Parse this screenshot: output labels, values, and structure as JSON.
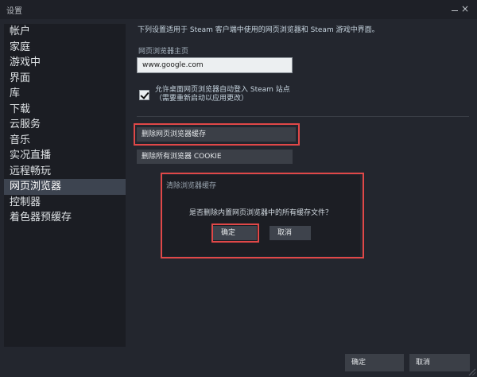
{
  "window": {
    "title": "设置",
    "minimize": "—",
    "close": "×"
  },
  "sidebar": {
    "items": [
      {
        "label": "帐户"
      },
      {
        "label": "家庭"
      },
      {
        "label": "游戏中"
      },
      {
        "label": "界面"
      },
      {
        "label": "库"
      },
      {
        "label": "下载"
      },
      {
        "label": "云服务"
      },
      {
        "label": "音乐"
      },
      {
        "label": "实况直播"
      },
      {
        "label": "远程畅玩"
      },
      {
        "label": "网页浏览器",
        "active": true
      },
      {
        "label": "控制器"
      },
      {
        "label": "着色器预缓存"
      }
    ]
  },
  "browser": {
    "description": "下列设置适用于 Steam 客户端中使用的网页浏览器和 Steam 游戏中界面。",
    "home_label": "网页浏览器主页",
    "home_value": "www.google.com",
    "auto_login_line1": "允许桌面网页浏览器自动登入 Steam 站点",
    "auto_login_line2": "（需要重新启动以应用更改）",
    "auto_login_checked": true,
    "delete_cache_label": "删除网页浏览器缓存",
    "delete_cookies_label": "删除所有浏览器 COOKIE"
  },
  "dialog": {
    "title": "清除浏览器缓存",
    "message": "是否删除内置网页浏览器中的所有缓存文件？",
    "ok_label": "确定",
    "cancel_label": "取消"
  },
  "footer": {
    "ok_label": "确定",
    "cancel_label": "取消"
  },
  "colors": {
    "background": "#23262e",
    "sidebar": "#1b1d23",
    "active_item": "#3d4450",
    "button": "#3b3f47",
    "highlight": "#e04848"
  }
}
